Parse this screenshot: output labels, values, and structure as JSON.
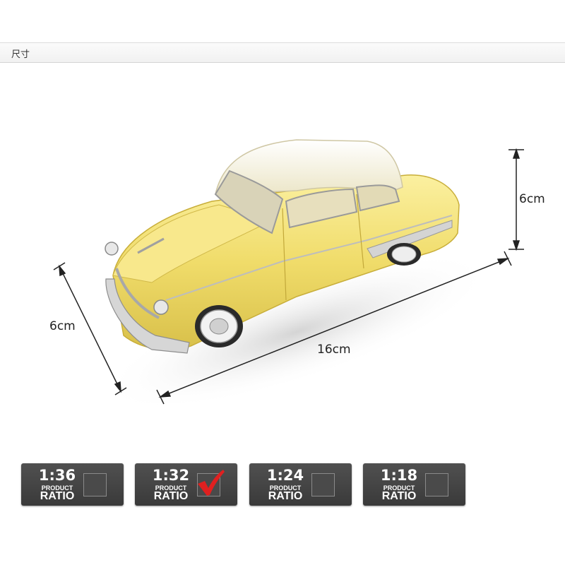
{
  "header": {
    "title": "尺寸"
  },
  "dimensions": {
    "height": "6cm",
    "width": "6cm",
    "length": "16cm"
  },
  "car": {
    "body_color": "#f3e27a",
    "roof_color": "#f7f3e0",
    "chrome_color": "#c9c9c9"
  },
  "scales": [
    {
      "ratio": "1:36",
      "product": "PRODUCT",
      "word": "RATIO",
      "checked": false
    },
    {
      "ratio": "1:32",
      "product": "PRODUCT",
      "word": "RATIO",
      "checked": true
    },
    {
      "ratio": "1:24",
      "product": "PRODUCT",
      "word": "RATIO",
      "checked": false
    },
    {
      "ratio": "1:18",
      "product": "PRODUCT",
      "word": "RATIO",
      "checked": false
    }
  ],
  "colors": {
    "check_mark": "#e02020",
    "badge_bg": "#454545"
  }
}
